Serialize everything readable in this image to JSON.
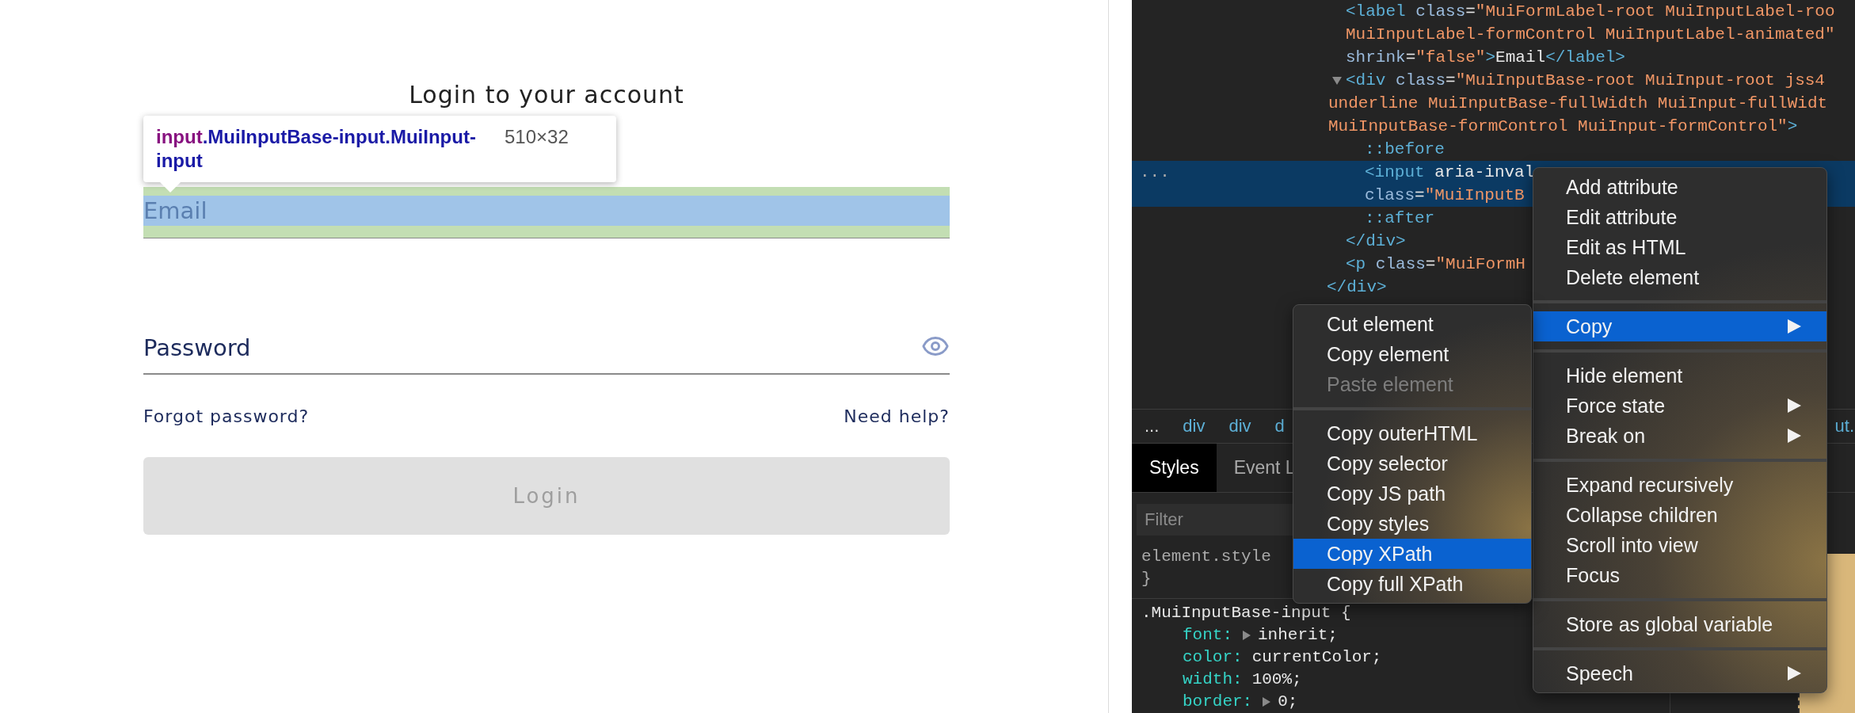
{
  "login_page": {
    "heading": "Login to your account",
    "inspect_tooltip": {
      "tag": "input",
      "selector": ".MuiInputBase-input.MuiInput-input",
      "size": "510×32"
    },
    "email_field": {
      "placeholder": "Email",
      "highlighted": true
    },
    "password_field": {
      "placeholder": "Password"
    },
    "links": [
      "Forgot password?",
      "Need help?"
    ],
    "login_button": {
      "label": "Login",
      "disabled": true
    }
  },
  "devtools": {
    "elements": {
      "closing": "</div>",
      "children": [
        {
          "lines": [
            "<label class=\"MuiFormLabel-root MuiInputLabel-roo",
            "MuiInputLabel-formControl MuiInputLabel-animated\"",
            "shrink=\"false\">Email</label>"
          ],
          "selected": false
        },
        {
          "lines": [
            "<div class=\"MuiInputBase-root MuiInput-root jss4",
            "underline MuiInputBase-fullWidth MuiInput-fullWidt",
            "MuiInputBase-formControl MuiInput-formControl\">"
          ],
          "selected": false,
          "expanded": true,
          "closing": "</div>",
          "children": [
            {
              "lines": [
                "::before"
              ],
              "selected": false
            },
            {
              "lines": [
                "<input aria-inval",
                "class=\"MuiInputB"
              ],
              "selected": true,
              "marker": "..."
            },
            {
              "lines": [
                "::after"
              ],
              "selected": false
            }
          ]
        },
        {
          "lines": [
            "<p class=\"MuiFormH"
          ],
          "selected": false
        }
      ]
    },
    "breadcrumbs": [
      "...",
      "div",
      "div",
      "d",
      "ut."
    ],
    "tabs": [
      {
        "label": "Styles",
        "selected": true
      },
      {
        "label": "Event L",
        "selected": false
      }
    ],
    "filter": {
      "placeholder": "Filter"
    },
    "styles": {
      "element_style": [
        "element.style",
        "}"
      ],
      "rule_selector": ".MuiInputBase-input {",
      "declarations": [
        {
          "name": "font:",
          "value": "inherit;",
          "expandable": true
        },
        {
          "name": "color:",
          "value": "currentColor;",
          "expandable": false
        },
        {
          "name": "width:",
          "value": "100%;",
          "expandable": false
        },
        {
          "name": "border:",
          "value": "0;",
          "expandable": true
        }
      ]
    },
    "context_menu": {
      "groups": [
        [
          {
            "label": "Add attribute",
            "submenu": false,
            "selected": false
          },
          {
            "label": "Edit attribute",
            "submenu": false,
            "selected": false
          },
          {
            "label": "Edit as HTML",
            "submenu": false,
            "selected": false
          },
          {
            "label": "Delete element",
            "submenu": false,
            "selected": false
          }
        ],
        [
          {
            "label": "Copy",
            "submenu": true,
            "selected": true
          }
        ],
        [
          {
            "label": "Hide element",
            "submenu": false,
            "selected": false
          },
          {
            "label": "Force state",
            "submenu": true,
            "selected": false
          },
          {
            "label": "Break on",
            "submenu": true,
            "selected": false
          }
        ],
        [
          {
            "label": "Expand recursively",
            "submenu": false,
            "selected": false
          },
          {
            "label": "Collapse children",
            "submenu": false,
            "selected": false
          },
          {
            "label": "Scroll into view",
            "submenu": false,
            "selected": false
          },
          {
            "label": "Focus",
            "submenu": false,
            "selected": false
          }
        ],
        [
          {
            "label": "Store as global variable",
            "submenu": false,
            "selected": false
          }
        ],
        [
          {
            "label": "Speech",
            "submenu": true,
            "selected": false
          }
        ]
      ]
    },
    "copy_submenu": {
      "groups": [
        [
          {
            "label": "Cut element",
            "disabled": false,
            "selected": false
          },
          {
            "label": "Copy element",
            "disabled": false,
            "selected": false
          },
          {
            "label": "Paste element",
            "disabled": true,
            "selected": false
          }
        ],
        [
          {
            "label": "Copy outerHTML",
            "disabled": false,
            "selected": false
          },
          {
            "label": "Copy selector",
            "disabled": false,
            "selected": false
          },
          {
            "label": "Copy JS path",
            "disabled": false,
            "selected": false
          },
          {
            "label": "Copy styles",
            "disabled": false,
            "selected": false
          },
          {
            "label": "Copy XPath",
            "disabled": false,
            "selected": true
          },
          {
            "label": "Copy full XPath",
            "disabled": false,
            "selected": false
          }
        ]
      ]
    }
  }
}
